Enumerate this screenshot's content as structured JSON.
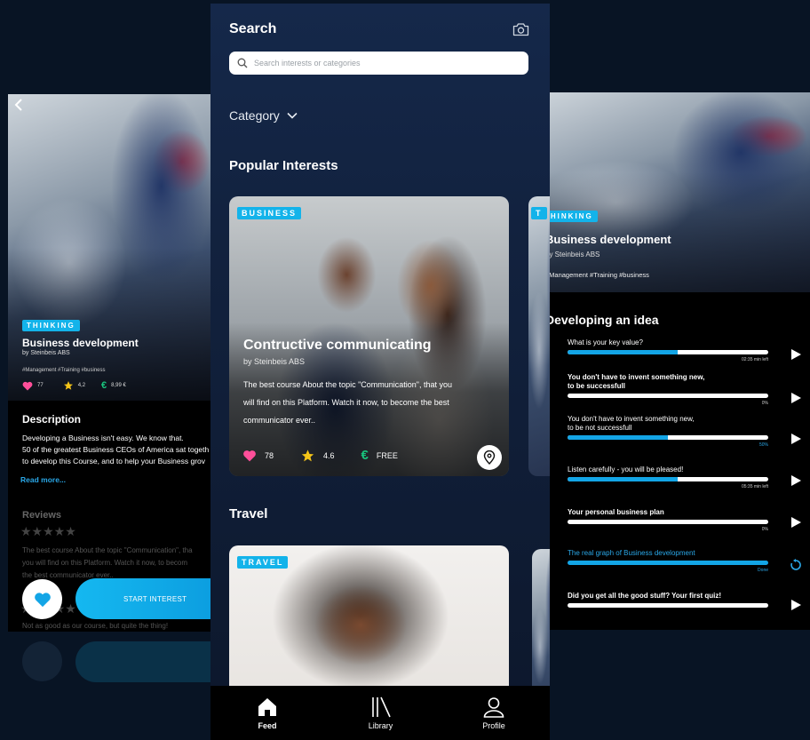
{
  "left_screen": {
    "badge": "THINKING",
    "title": "Business development",
    "author": "by Steinbeis ABS",
    "tags": "#Management #Training #business",
    "stats": {
      "likes": "77",
      "rating": "4,2",
      "price": "8,99 €"
    },
    "description_title": "Description",
    "description_lines": [
      "Developing a Business isn't easy. We know that.",
      "50 of the greatest Business CEOs of America sat togeth",
      "to develop this Course, and to help your Business grov"
    ],
    "read_more": "Read more...",
    "reviews_title": "Reviews",
    "review_stars": "★★★★★",
    "review_lines": [
      "The best course About the topic \"Communication\", tha",
      "you will find on this Platform. Watch it now, to becom",
      "the best communicator ever.."
    ],
    "review2_line": "Not as good as our course, but quite the thing!",
    "start_button": "START INTEREST"
  },
  "search": {
    "title": "Search",
    "placeholder": "Search interests or categories",
    "category_label": "Category"
  },
  "popular": {
    "title": "Popular Interests",
    "card": {
      "badge": "BUSINESS",
      "title": "Contructive communicating",
      "author": "by Steinbeis ABS",
      "description_lines": [
        "The best course About the topic \"Communication\", that you",
        "will find on this Platform. Watch it now, to become the best",
        "communicator ever.."
      ],
      "likes": "78",
      "rating": "4.6",
      "price": "FREE"
    }
  },
  "travel": {
    "title": "Travel",
    "badge": "TRAVEL"
  },
  "tabs": [
    {
      "label": "Feed",
      "icon": "home-icon",
      "active": true
    },
    {
      "label": "Library",
      "icon": "library-icon",
      "active": false
    },
    {
      "label": "Profile",
      "icon": "profile-icon",
      "active": false
    }
  ],
  "right_screen": {
    "badge": "THINKING",
    "title": "Business development",
    "author": "by Steinbeis ABS",
    "tags": "#Management #Training #business",
    "section_title": "Developing an idea",
    "steps": [
      {
        "title_line1": "What is your key value?",
        "title_line2": "",
        "progress": 0.55,
        "meta": "02:35 min left",
        "style": "normal",
        "action": "play-icon"
      },
      {
        "title_line1": "You don't have to invent something new,",
        "title_line2": "to be successfull",
        "progress": 0.0,
        "meta": "0%",
        "style": "bold",
        "action": "play-icon"
      },
      {
        "title_line1": "You don't have to invent something new,",
        "title_line2": "to be not successfull",
        "progress": 0.5,
        "meta": "50%",
        "style": "normal",
        "action": "play-icon"
      },
      {
        "title_line1": "Listen carefully - you will be pleased!",
        "title_line2": "",
        "progress": 0.55,
        "meta": "05:35 min left",
        "style": "normal",
        "action": "play-icon"
      },
      {
        "title_line1": "Your personal business plan",
        "title_line2": "",
        "progress": 0.0,
        "meta": "0%",
        "style": "bold",
        "action": "play-icon"
      },
      {
        "title_line1": "The real graph of Business development",
        "title_line2": "",
        "progress": 1.0,
        "meta": "Done",
        "style": "blue",
        "action": "replay-icon"
      },
      {
        "title_line1": "Did you get all the good stuff? Your first quiz!",
        "title_line2": "",
        "progress": 0.0,
        "meta": "",
        "style": "bold",
        "action": "play-icon"
      }
    ]
  },
  "colors": {
    "accent": "#13b3ea",
    "background": "#081424",
    "panel": "#12223f",
    "heart": "#ff4f9a",
    "star": "#f5c518",
    "euro": "#19c37d"
  }
}
